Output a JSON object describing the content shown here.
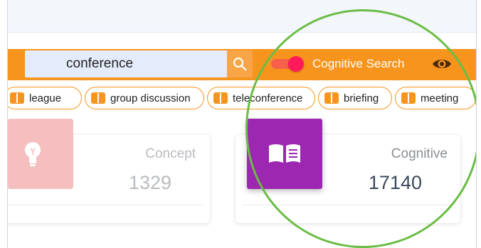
{
  "search": {
    "value": "conference"
  },
  "cognitive_toggle": {
    "label": "Cognitive Search",
    "enabled": true
  },
  "chips": [
    {
      "label": "league"
    },
    {
      "label": "group discussion"
    },
    {
      "label": "teleconference"
    },
    {
      "label": "briefing"
    },
    {
      "label": "meeting"
    }
  ],
  "cards": [
    {
      "title": "Concept",
      "count": "1329",
      "icon": "lightbulb-icon"
    },
    {
      "title": "Cognitive",
      "count": "17140",
      "icon": "book-icon"
    }
  ],
  "colors": {
    "toolbar": "#f7941d",
    "accent_purple": "#9c27b0",
    "accent_pink": "#f6bfbf",
    "highlight_circle": "#6abd45"
  }
}
